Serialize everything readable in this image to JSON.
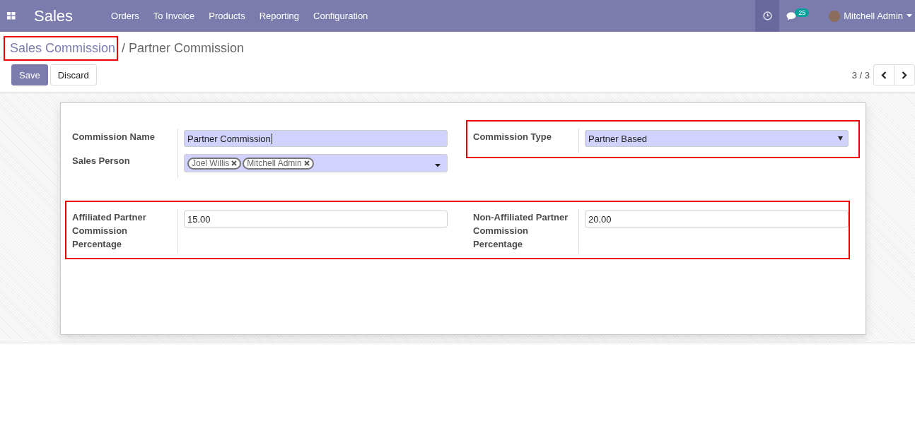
{
  "navbar": {
    "app_name": "Sales",
    "menu": [
      "Orders",
      "To Invoice",
      "Products",
      "Reporting",
      "Configuration"
    ],
    "message_count": "25",
    "user": "Mitchell Admin"
  },
  "breadcrumb": {
    "items": [
      {
        "label": "Sales Commission",
        "highlighted": true
      },
      {
        "label": "Partner Commission",
        "highlighted": false
      }
    ],
    "separator": "/"
  },
  "buttons": [
    {
      "label": "Save",
      "kind": "primary"
    },
    {
      "label": "Discard",
      "kind": "secondary"
    }
  ],
  "pager": "3 / 3",
  "form": {
    "rows": [
      {
        "highlighted": false,
        "groups": [
          {
            "highlighted": false,
            "fields": [
              {
                "label": "Commission Name",
                "kind": "text",
                "value": "Partner Commission",
                "required": true,
                "focused": true
              },
              {
                "label": "Sales Person",
                "kind": "tags",
                "tags": [
                  "Joel Willis",
                  "Mitchell Admin"
                ],
                "required": true
              }
            ]
          },
          {
            "highlighted": true,
            "fields": [
              {
                "label": "Commission Type",
                "kind": "select",
                "value": "Partner Based",
                "required": true
              }
            ]
          }
        ]
      },
      {
        "highlighted": true,
        "groups": [
          {
            "highlighted": false,
            "fields": [
              {
                "label": "Affiliated Partner Commission Percentage",
                "kind": "text",
                "value": "15.00",
                "required": false,
                "focused": false
              }
            ]
          },
          {
            "highlighted": false,
            "fields": [
              {
                "label": "Non-Affiliated Partner Commission Percentage",
                "kind": "text",
                "value": "20.00",
                "required": false,
                "focused": false
              }
            ]
          }
        ]
      }
    ]
  }
}
